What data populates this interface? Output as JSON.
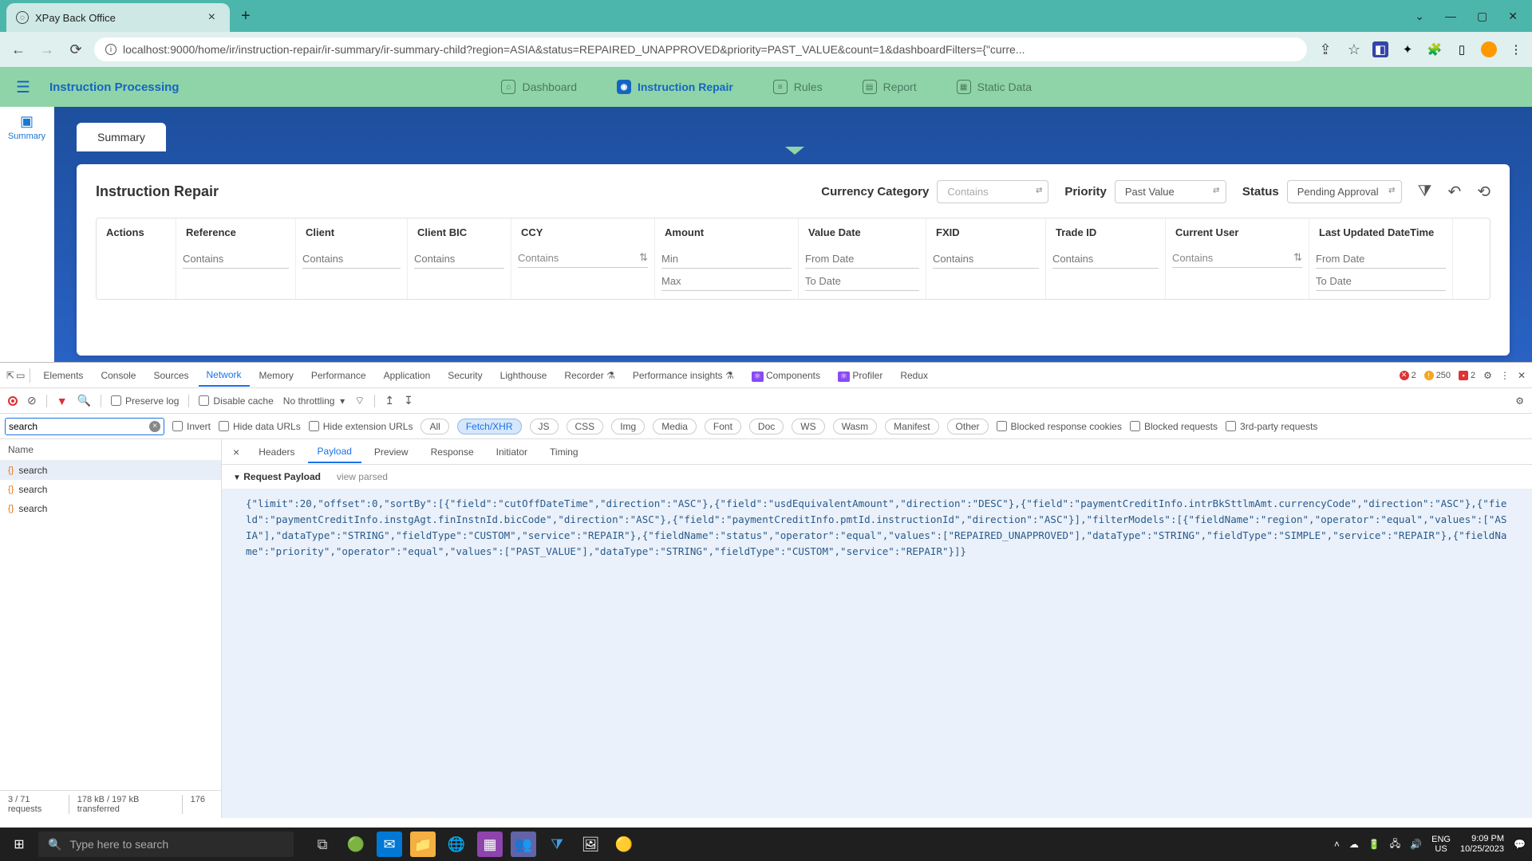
{
  "browser": {
    "tab_title": "XPay Back Office",
    "url": "localhost:9000/home/ir/instruction-repair/ir-summary/ir-summary-child?region=ASIA&status=REPAIRED_UNAPPROVED&priority=PAST_VALUE&count=1&dashboardFilters={\"curre..."
  },
  "nav": {
    "title": "Instruction Processing",
    "items": [
      {
        "label": "Dashboard"
      },
      {
        "label": "Instruction Repair",
        "active": true
      },
      {
        "label": "Rules"
      },
      {
        "label": "Report"
      },
      {
        "label": "Static Data"
      }
    ]
  },
  "sidebar": {
    "label": "Summary"
  },
  "tabpill": {
    "label": "Summary"
  },
  "card": {
    "title": "Instruction Repair",
    "filters": {
      "currency_label": "Currency Category",
      "currency_value": "Contains",
      "priority_label": "Priority",
      "priority_value": "Past Value",
      "status_label": "Status",
      "status_value": "Pending Approval"
    },
    "columns": [
      "Actions",
      "Reference",
      "Client",
      "Client BIC",
      "CCY",
      "Amount",
      "Value Date",
      "FXID",
      "Trade ID",
      "Current User",
      "Last Updated DateTime"
    ],
    "col_filters": [
      "",
      "Contains",
      "Contains",
      "Contains",
      "Contains",
      "Min",
      "From Date",
      "Contains",
      "Contains",
      "Contains",
      "From Date"
    ],
    "col_filters2": {
      "amount": "Max",
      "valuedate": "To Date",
      "lastupdated": "To Date"
    }
  },
  "devtools": {
    "tabs": [
      "Elements",
      "Console",
      "Sources",
      "Network",
      "Memory",
      "Performance",
      "Application",
      "Security",
      "Lighthouse",
      "Recorder",
      "Performance insights"
    ],
    "ext_tabs": [
      "Components",
      "Profiler",
      "Redux"
    ],
    "active_tab": "Network",
    "errors": "2",
    "warnings": "250",
    "issues": "2",
    "toolbar": {
      "preserve": "Preserve log",
      "disable_cache": "Disable cache",
      "throttle": "No throttling"
    },
    "filter": {
      "search_value": "search",
      "invert": "Invert",
      "hide_urls": "Hide data URLs",
      "hide_ext": "Hide extension URLs",
      "types": [
        "All",
        "Fetch/XHR",
        "JS",
        "CSS",
        "Img",
        "Media",
        "Font",
        "Doc",
        "WS",
        "Wasm",
        "Manifest",
        "Other"
      ],
      "active_type": "Fetch/XHR",
      "blocked_cookies": "Blocked response cookies",
      "blocked_req": "Blocked requests",
      "third_party": "3rd-party requests"
    },
    "requests": {
      "header": "Name",
      "items": [
        "search",
        "search",
        "search"
      ],
      "status": {
        "count": "3 / 71 requests",
        "size": "178 kB / 197 kB transferred",
        "extra": "176"
      }
    },
    "detail": {
      "tabs": [
        "Headers",
        "Payload",
        "Preview",
        "Response",
        "Initiator",
        "Timing"
      ],
      "active": "Payload",
      "section_label": "Request Payload",
      "view_parsed": "view parsed",
      "body": "{\"limit\":20,\"offset\":0,\"sortBy\":[{\"field\":\"cutOffDateTime\",\"direction\":\"ASC\"},{\"field\":\"usdEquivalentAmount\",\"direction\":\"DESC\"},{\"field\":\"paymentCreditInfo.intrBkSttlmAmt.currencyCode\",\"direction\":\"ASC\"},{\"field\":\"paymentCreditInfo.instgAgt.finInstnId.bicCode\",\"direction\":\"ASC\"},{\"field\":\"paymentCreditInfo.pmtId.instructionId\",\"direction\":\"ASC\"}],\"filterModels\":[{\"fieldName\":\"region\",\"operator\":\"equal\",\"values\":[\"ASIA\"],\"dataType\":\"STRING\",\"fieldType\":\"CUSTOM\",\"service\":\"REPAIR\"},{\"fieldName\":\"status\",\"operator\":\"equal\",\"values\":[\"REPAIRED_UNAPPROVED\"],\"dataType\":\"STRING\",\"fieldType\":\"SIMPLE\",\"service\":\"REPAIR\"},{\"fieldName\":\"priority\",\"operator\":\"equal\",\"values\":[\"PAST_VALUE\"],\"dataType\":\"STRING\",\"fieldType\":\"CUSTOM\",\"service\":\"REPAIR\"}]}"
    }
  },
  "taskbar": {
    "search_placeholder": "Type here to search",
    "lang": "ENG",
    "locale": "US",
    "time": "9:09 PM",
    "date": "10/25/2023"
  }
}
